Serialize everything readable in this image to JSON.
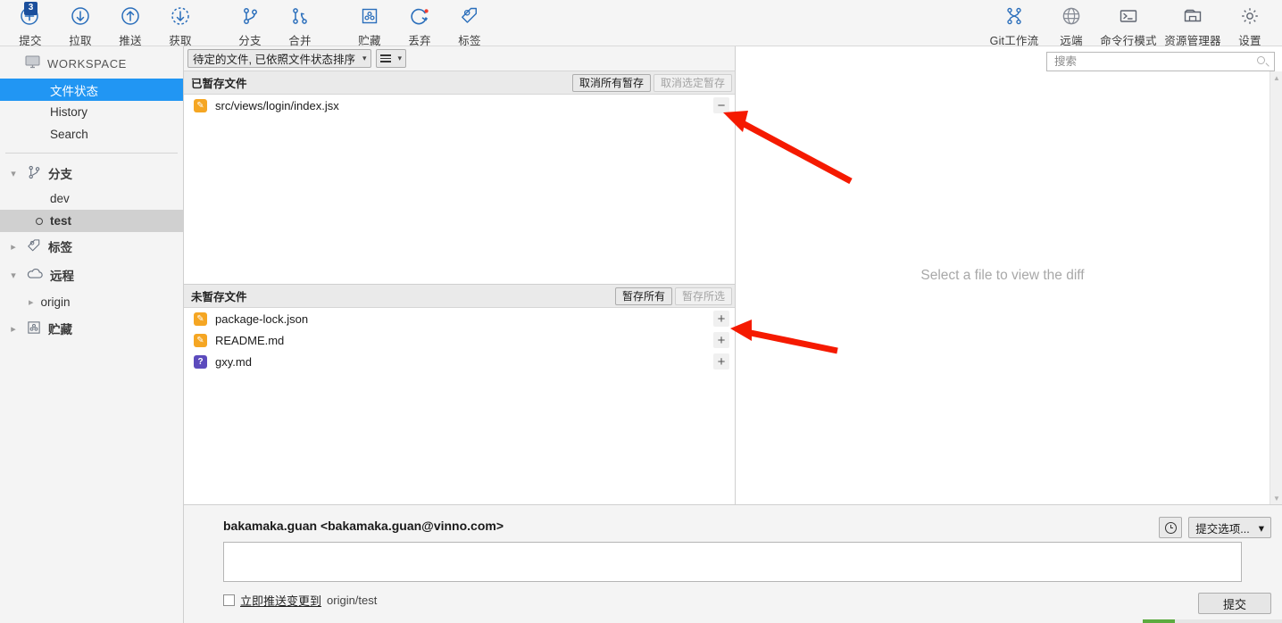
{
  "toolbar": {
    "left_items": [
      {
        "label": "提交",
        "icon": "commit-plus-icon",
        "badge": "3"
      },
      {
        "label": "拉取",
        "icon": "pull-down-arrow-icon"
      },
      {
        "label": "推送",
        "icon": "push-up-arrow-icon"
      },
      {
        "label": "获取",
        "icon": "fetch-dashed-arrow-icon"
      },
      {
        "label": "分支",
        "icon": "branch-icon"
      },
      {
        "label": "合并",
        "icon": "merge-icon"
      },
      {
        "label": "贮藏",
        "icon": "stash-box-icon"
      },
      {
        "label": "丢弃",
        "icon": "discard-refresh-icon"
      },
      {
        "label": "标签",
        "icon": "tag-icon"
      }
    ],
    "right_items": [
      {
        "label": "Git工作流",
        "icon": "git-flow-icon"
      },
      {
        "label": "远端",
        "icon": "globe-icon"
      },
      {
        "label": "命令行模式",
        "icon": "terminal-icon"
      },
      {
        "label": "资源管理器",
        "icon": "folder-explorer-icon"
      },
      {
        "label": "设置",
        "icon": "gear-icon"
      }
    ]
  },
  "sidebar": {
    "workspace_label": "WORKSPACE",
    "nav": [
      {
        "label": "文件状态",
        "active": true
      },
      {
        "label": "History",
        "active": false
      },
      {
        "label": "Search",
        "active": false
      }
    ],
    "branches": {
      "group_label": "分支",
      "expanded": true,
      "items": [
        {
          "label": "dev",
          "current": false
        },
        {
          "label": "test",
          "current": true
        }
      ]
    },
    "tags": {
      "group_label": "标签",
      "expanded": false
    },
    "remotes": {
      "group_label": "远程",
      "expanded": true,
      "items": [
        {
          "label": "origin"
        }
      ]
    },
    "stashes": {
      "group_label": "贮藏",
      "expanded": false
    }
  },
  "filterbar": {
    "sort_value": "待定的文件, 已依照文件状态排序",
    "view_icon": "list-view-icon"
  },
  "staged": {
    "title": "已暂存文件",
    "unstage_all_label": "取消所有暂存",
    "unstage_selected_label": "取消选定暂存",
    "unstage_selected_disabled": true,
    "files": [
      {
        "name": "src/views/login/index.jsx",
        "status": "modified",
        "action": "−"
      }
    ]
  },
  "unstaged": {
    "title": "未暂存文件",
    "stage_all_label": "暂存所有",
    "stage_selected_label": "暂存所选",
    "stage_selected_disabled": true,
    "files": [
      {
        "name": "package-lock.json",
        "status": "modified",
        "action": "+"
      },
      {
        "name": "README.md",
        "status": "modified",
        "action": "+"
      },
      {
        "name": "gxy.md",
        "status": "untracked",
        "action": "+"
      }
    ]
  },
  "diff": {
    "search_placeholder": "搜索",
    "search_value": "",
    "empty_message": "Select a file to view the diff"
  },
  "commit": {
    "author": "bakamaka.guan <bakamaka.guan@vinno.com>",
    "message_value": "",
    "push_checkbox_checked": false,
    "push_label": "立即推送变更到",
    "push_target": "origin/test",
    "history_icon": "clock-icon",
    "options_label": "提交选项...",
    "commit_label": "提交"
  },
  "colors": {
    "accent": "#2196f3",
    "toolbar_icon": "#2a6ebb",
    "modified": "#f5a623",
    "untracked": "#5c4bbd",
    "annotation": "#f51a00",
    "progress": "#5cab3f"
  }
}
